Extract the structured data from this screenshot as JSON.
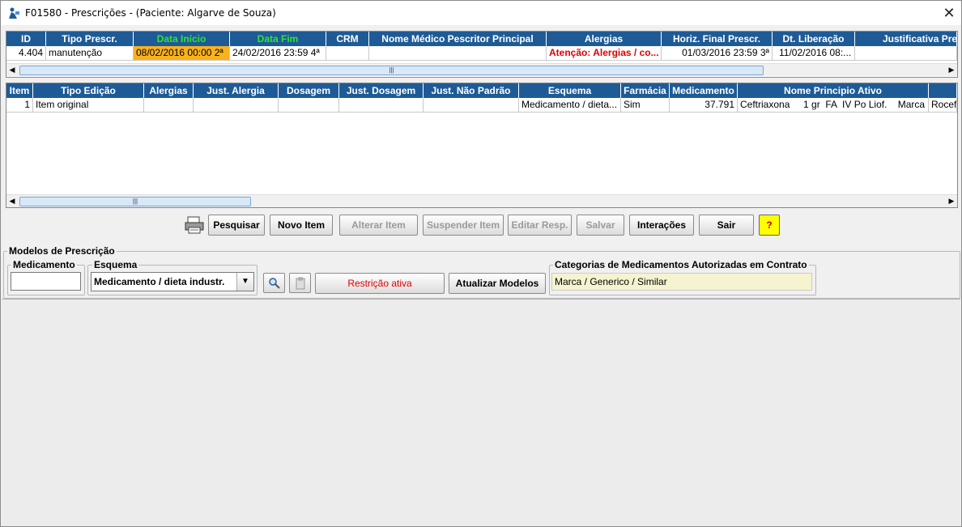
{
  "window": {
    "title": "F01580 - Prescrições - (Paciente: Algarve de Souza)",
    "close_icon": "close-icon",
    "app_icon": "app-icon"
  },
  "prescriptions_table": {
    "columns": [
      "ID",
      "Tipo Prescr.",
      "Data Início",
      "Data Fim",
      "CRM",
      "Nome Médico Pescritor Principal",
      "Alergias",
      "Horiz. Final Prescr.",
      "Dt. Liberação",
      "Justificativa Pre"
    ],
    "rows": [
      {
        "id": "4.404",
        "tipo": "manutenção",
        "data_inicio": "08/02/2016 00:00 2ª",
        "data_fim": "24/02/2016 23:59 4ª",
        "crm": "",
        "medico": "",
        "alergias": "Atenção: Alergias / co...",
        "horiz": "01/03/2016 23:59 3ª",
        "liberacao": "11/02/2016 08:...",
        "justificativa": ""
      }
    ]
  },
  "items_table": {
    "columns": [
      "Item",
      "Tipo Edição",
      "Alergias",
      "Just. Alergia",
      "Dosagem",
      "Just. Dosagem",
      "Just. Não Padrão",
      "Esquema",
      "Farmácia",
      "Medicamento",
      "Nome Principio Ativo",
      ""
    ],
    "rows": [
      {
        "item": "1",
        "tipo": "Item original",
        "alergias": "",
        "just_alergia": "",
        "dosagem": "",
        "just_dosagem": "",
        "just_nao_padrao": "",
        "esquema": "Medicamento / dieta...",
        "farmacia": "Sim",
        "medicamento": "37.791",
        "principio": "Ceftriaxona     1 gr  FA  IV Po Liof.    Marca",
        "extra": "Rocef"
      }
    ]
  },
  "toolbar": {
    "print_icon": "printer-icon",
    "pesquisar": "Pesquisar",
    "novo_item": "Novo Item",
    "alterar_item": "Alterar Item",
    "suspender_item": "Suspender Item",
    "editar_resp": "Editar Resp.",
    "salvar": "Salvar",
    "interacoes": "Interações",
    "sair": "Sair",
    "help": "?"
  },
  "modelos": {
    "legend": "Modelos de Prescrição",
    "medicamento_label": "Medicamento",
    "medicamento_value": "",
    "esquema_label": "Esquema",
    "esquema_value": "Medicamento / dieta industr.",
    "search_icon": "search-icon",
    "clipboard_icon": "clipboard-icon",
    "restricao": "Restrição ativa",
    "atualizar": "Atualizar Modelos",
    "categorias_label": "Categorias de Medicamentos Autorizadas em Contrato",
    "categorias_value": "Marca / Generico / Similar"
  },
  "colors": {
    "header_bg": "#1e5b96",
    "highlight_orange": "#f9b11c",
    "alert_red": "#e00000",
    "green_header": "#2ee52e"
  }
}
